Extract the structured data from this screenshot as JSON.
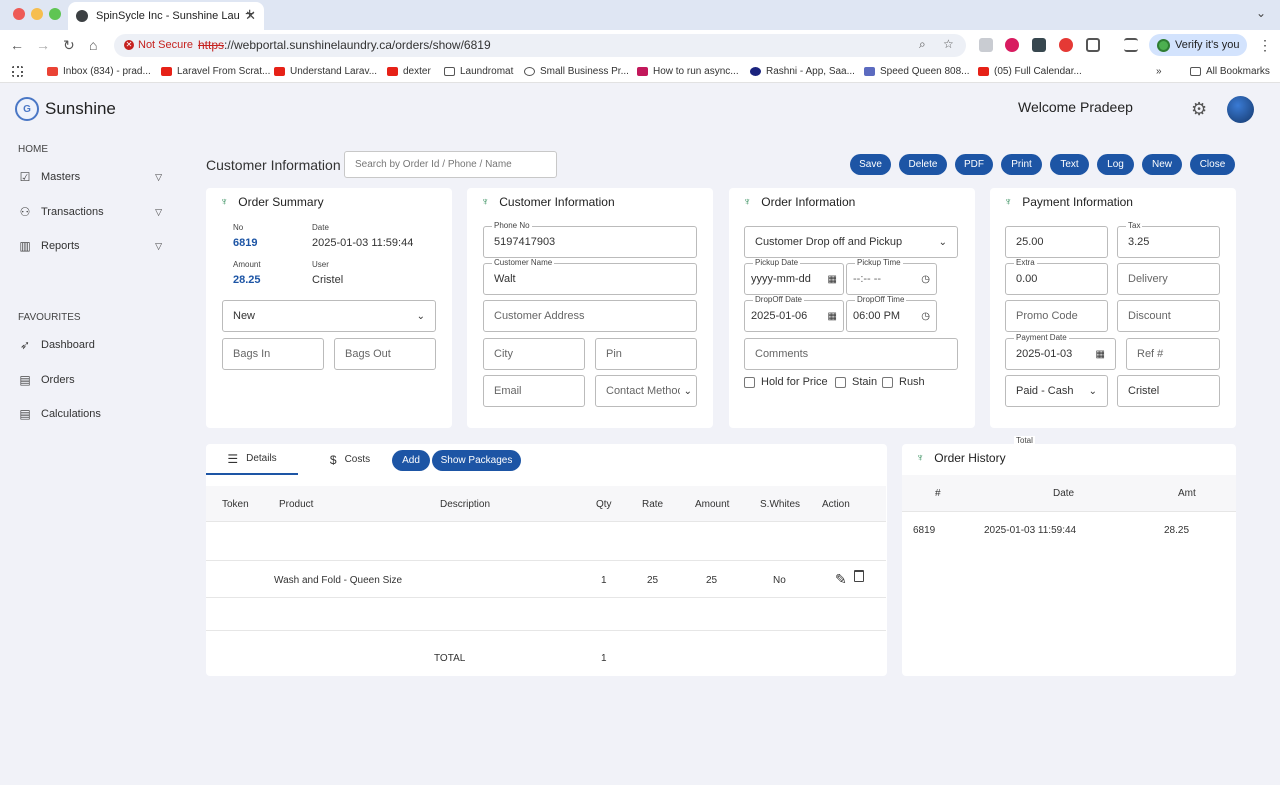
{
  "browser": {
    "tab_title": "SpinSycle Inc - Sunshine Lau",
    "not_secure": "Not Secure",
    "url_scheme": "https",
    "url_rest": "://webportal.sunshinelaundry.ca/orders/show/6819",
    "verify": "Verify it's you",
    "bookmarks": [
      "Inbox (834) - prad...",
      "Laravel From Scrat...",
      "Understand Larav...",
      "dexter",
      "Laundromat",
      "Small Business Pr...",
      "How to run async...",
      "Rashni - App, Saa...",
      "Speed Queen 808...",
      "(05) Full Calendar...",
      "All Bookmarks"
    ]
  },
  "app": {
    "brand": "Sunshine",
    "logo_letter": "G",
    "welcome": "Welcome Pradeep",
    "sidebar": {
      "home": "HOME",
      "items": [
        {
          "label": "Masters"
        },
        {
          "label": "Transactions"
        },
        {
          "label": "Reports"
        }
      ],
      "favourites": "FAVOURITES",
      "fav_items": [
        {
          "label": "Dashboard"
        },
        {
          "label": "Orders"
        },
        {
          "label": "Calculations"
        }
      ]
    },
    "page_title": "Customer Information",
    "search_placeholder": "Search by Order Id / Phone / Name",
    "actions": [
      "Save",
      "Delete",
      "PDF",
      "Print",
      "Text",
      "Log",
      "New",
      "Close"
    ]
  },
  "order_summary": {
    "title": "Order Summary",
    "no_label": "No",
    "no": "6819",
    "date_label": "Date",
    "date": "2025-01-03 11:59:44",
    "amount_label": "Amount",
    "amount": "28.25",
    "user_label": "User",
    "user": "Cristel",
    "status": "New",
    "bags_in": "Bags In",
    "bags_out": "Bags Out"
  },
  "customer": {
    "title": "Customer Information",
    "phone_label": "Phone No",
    "phone": "5197417903",
    "name_label": "Customer Name",
    "name": "Walt",
    "address": "Customer Address",
    "city": "City",
    "pin": "Pin",
    "email": "Email",
    "contact": "Contact Method"
  },
  "order_info": {
    "title": "Order Information",
    "type": "Customer Drop off and Pickup",
    "pickup_date_label": "Pickup Date",
    "pickup_date": "yyyy-mm-dd",
    "pickup_time_label": "Pickup Time",
    "pickup_time": "--:-- --",
    "dropoff_date_label": "DropOff Date",
    "dropoff_date": "2025-01-06",
    "dropoff_time_label": "DropOff Time",
    "dropoff_time": "06:00 PM",
    "comments": "Comments",
    "hold": "Hold for Price",
    "stain": "Stain",
    "rush": "Rush"
  },
  "payment": {
    "title": "Payment Information",
    "total_label": "Total",
    "total": "25.00",
    "tax_label": "Tax",
    "tax": "3.25",
    "extra_label": "Extra",
    "extra": "0.00",
    "delivery": "Delivery",
    "promo": "Promo Code",
    "discount": "Discount",
    "payment_date_label": "Payment Date",
    "payment_date": "2025-01-03",
    "ref": "Ref #",
    "method": "Paid - Cash",
    "user": "Cristel"
  },
  "details": {
    "tab_details": "Details",
    "tab_costs": "Costs",
    "add": "Add",
    "show_packages": "Show Packages",
    "columns": [
      "Token",
      "Product",
      "Description",
      "Qty",
      "Rate",
      "Amount",
      "S.Whites",
      "Action"
    ],
    "row": {
      "token": "",
      "product": "Wash and Fold - Queen Size",
      "description": "",
      "qty": "1",
      "rate": "25",
      "amount": "25",
      "swhites": "No"
    },
    "total_label": "TOTAL",
    "total_qty": "1"
  },
  "history": {
    "title": "Order History",
    "columns": [
      "#",
      "Date",
      "Amt"
    ],
    "row": {
      "no": "6819",
      "date": "2025-01-03 11:59:44",
      "amt": "28.25"
    }
  }
}
